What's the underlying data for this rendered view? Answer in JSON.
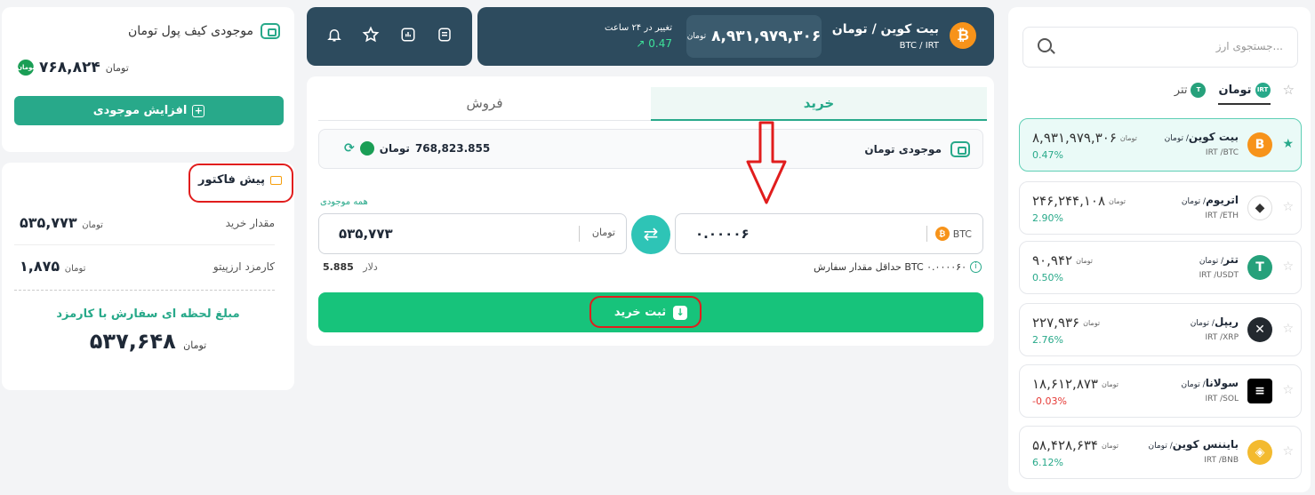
{
  "wallet": {
    "title": "موجودی کیف پول تومان",
    "balance": "۷۶۸,۸۲۴",
    "unit": "تومان",
    "coin_label": "تومان",
    "add_label": "افزایش موجودی"
  },
  "invoice": {
    "title": "پیش فاکتور",
    "buy_amount_label": "مقدار خرید",
    "buy_amount": "۵۳۵,۷۷۳",
    "fee_label": "کارمزد ارزپیتو",
    "fee": "۱,۸۷۵",
    "unit": "تومان",
    "final_label": "مبلغ لحظه ای سفارش با کارمزد",
    "final_value": "۵۳۷,۶۴۸"
  },
  "ticker": {
    "name": "بیت کوین / تومان",
    "pair": "BTC / IRT",
    "price": "۸,۹۳۱,۹۷۹,۳۰۶",
    "unit": "تومان",
    "change_label": "تغییر در ۲۴ ساعت",
    "change_value": "0.47"
  },
  "trade": {
    "tab_buy": "خرید",
    "tab_sell": "فروش",
    "balance_label": "موجودی تومان",
    "balance_value": "768,823.855",
    "balance_unit": "تومان",
    "all_balance": "همه موجودی",
    "irt_value": "۵۳۵,۷۷۳",
    "irt_unit": "تومان",
    "btc_value": "۰.۰۰۰۰۶",
    "btc_unit": "BTC",
    "min_order": "حداقل مقدار سفارش BTC ۰.۰۰۰۰۶۰",
    "usd_value": "5.885",
    "usd_unit": "دلار",
    "submit_label": "ثبت خرید"
  },
  "market": {
    "search_placeholder": "جستجوی ارز...",
    "filter_toman": "تومان",
    "filter_tether": "تتر",
    "badge_irt": "IRT",
    "rows": [
      {
        "name": "بیت کوین",
        "quote": "/ تومان",
        "pair": "IRT /BTC",
        "price": "۸,۹۳۱,۹۷۹,۳۰۶",
        "unit": "تومان",
        "change": "0.47%",
        "color": "#f7931a",
        "icon": "bitcoin-icon",
        "glyph": "B"
      },
      {
        "name": "اتریوم",
        "quote": "/ تومان",
        "pair": "IRT /ETH",
        "price": "۲۴۶,۲۴۴,۱۰۸",
        "unit": "تومان",
        "change": "2.90%",
        "color": "#ffffff",
        "icon": "ethereum-icon",
        "glyph": "◆"
      },
      {
        "name": "تتر",
        "quote": "/ تومان",
        "pair": "IRT /USDT",
        "price": "۹۰,۹۴۲",
        "unit": "تومان",
        "change": "0.50%",
        "color": "#26a17b",
        "icon": "tether-icon",
        "glyph": "T"
      },
      {
        "name": "ریپل",
        "quote": "/ تومان",
        "pair": "IRT /XRP",
        "price": "۲۲۷,۹۳۶",
        "unit": "تومان",
        "change": "2.76%",
        "color": "#23292f",
        "icon": "ripple-icon",
        "glyph": "✕"
      },
      {
        "name": "سولانا",
        "quote": "/ تومان",
        "pair": "IRT /SOL",
        "price": "۱۸,۶۱۲,۸۷۳",
        "unit": "تومان",
        "change": "-0.03%",
        "color": "#000000",
        "icon": "solana-icon",
        "glyph": "≡"
      },
      {
        "name": "بایننس کوین",
        "quote": "/ تومان",
        "pair": "IRT /BNB",
        "price": "۵۸,۴۲۸,۶۳۴",
        "unit": "تومان",
        "change": "6.12%",
        "color": "#f3ba2f",
        "icon": "bnb-icon",
        "glyph": "◈"
      }
    ]
  }
}
